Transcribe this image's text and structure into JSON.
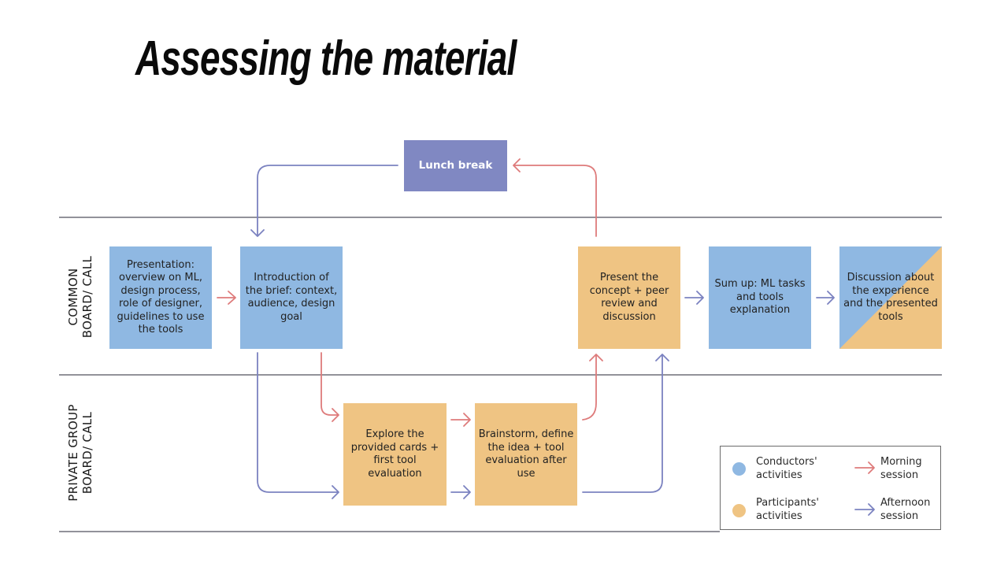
{
  "title": "Assessing the material",
  "colors": {
    "conductor": "#8fb8e2",
    "participant": "#efc483",
    "lunch": "#8088c2",
    "morning": "#de7b7b",
    "afternoon": "#7b82c0",
    "divider": "#6f6f78"
  },
  "lanes": {
    "common": "COMMON\nBOARD/ CALL",
    "private": "PRIVATE GROUP\nBOARD/ CALL"
  },
  "boxes": {
    "lunch": "Lunch break",
    "presentation": "Presentation: overview on ML, design process, role of designer, guidelines to use the tools",
    "introduction": "Introduction of the brief: context, audience, design goal",
    "present_concept": "Present the concept + peer review and discussion",
    "sum_up": "Sum up: ML tasks and tools explanation",
    "discussion": "Discussion about the experience and the presented tools",
    "explore": "Explore the provided cards + first tool evaluation",
    "brainstorm": "Brainstorm, define the idea + tool evaluation after use"
  },
  "legend": {
    "conductors": "Conductors' activities",
    "participants": "Participants' activities",
    "morning": "Morning session",
    "afternoon": "Afternoon session"
  }
}
